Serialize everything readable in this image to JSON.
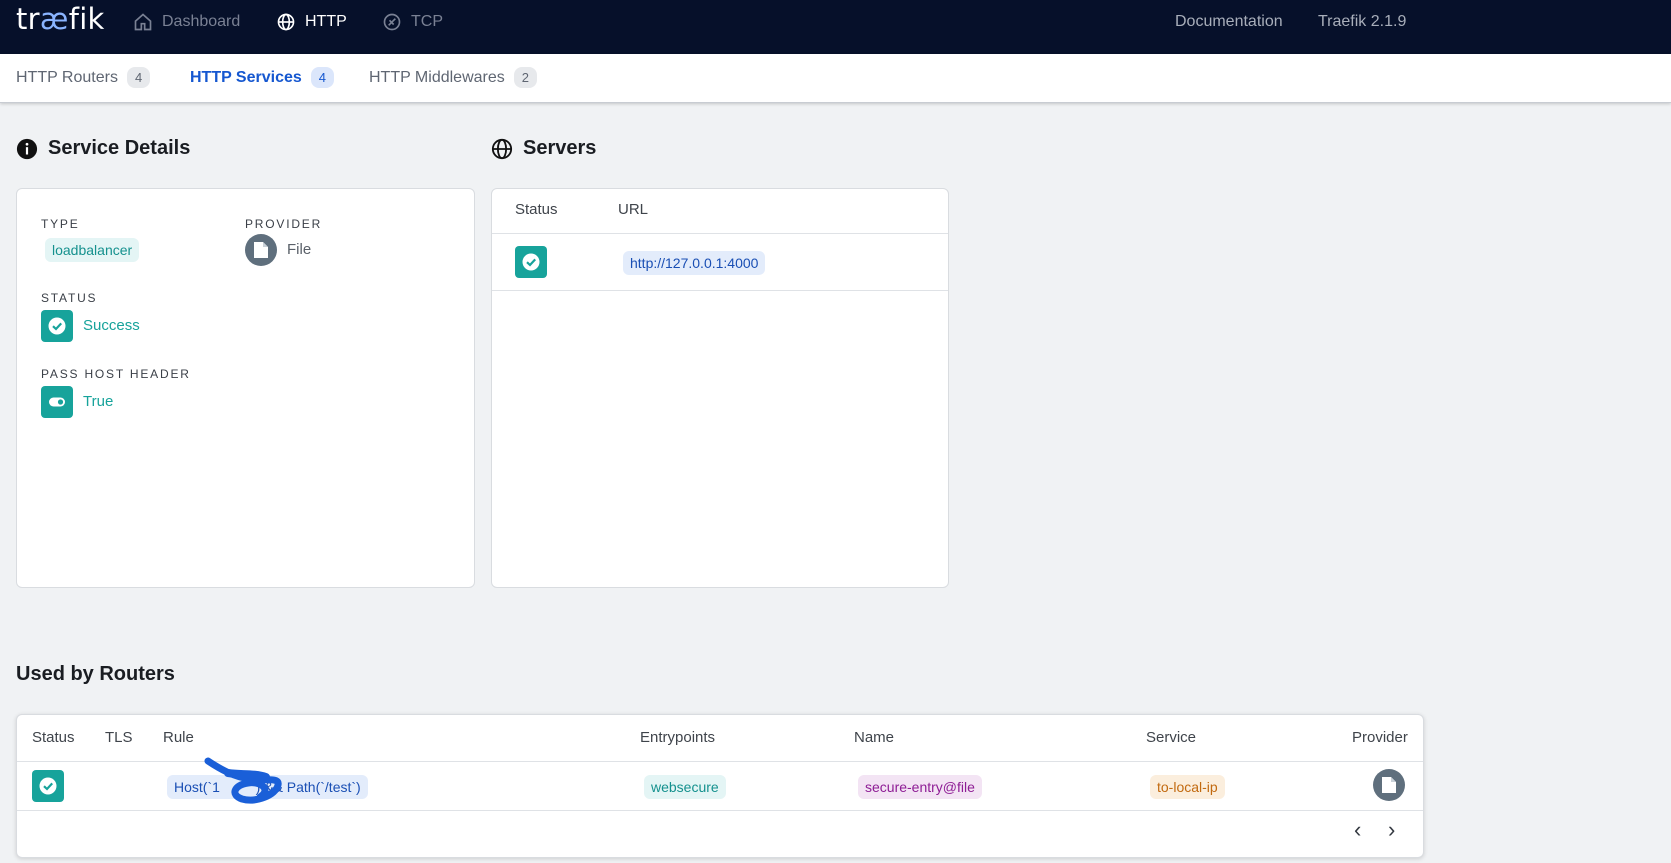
{
  "app": {
    "logo_prefix": "tr",
    "logo_ae": "æ",
    "logo_suffix": "fik",
    "brand_color": "#06102a",
    "accent_color": "#1557d0",
    "success_color": "#17a39b"
  },
  "topnav": {
    "dashboard": "Dashboard",
    "http": "HTTP",
    "tcp": "TCP",
    "documentation": "Documentation",
    "version": "Traefik 2.1.9"
  },
  "subnav": {
    "routers": {
      "label": "HTTP Routers",
      "count": "4"
    },
    "services": {
      "label": "HTTP Services",
      "count": "4",
      "active": true
    },
    "middlewares": {
      "label": "HTTP Middlewares",
      "count": "2"
    }
  },
  "service_details": {
    "title": "Service Details",
    "type_label": "TYPE",
    "type_value": "loadbalancer",
    "provider_label": "PROVIDER",
    "provider_value": "File",
    "status_label": "STATUS",
    "status_value": "Success",
    "pass_host_label": "PASS HOST HEADER",
    "pass_host_value": "True"
  },
  "servers": {
    "title": "Servers",
    "columns": [
      "Status",
      "URL"
    ],
    "rows": [
      {
        "status": "success",
        "url": "http://127.0.0.1:4000"
      }
    ]
  },
  "used_by_routers": {
    "title": "Used by Routers",
    "columns": [
      "Status",
      "TLS",
      "Rule",
      "Entrypoints",
      "Name",
      "Service",
      "Provider"
    ],
    "rows": [
      {
        "status": "success",
        "tls": "",
        "rule": "Host(`1        `) && Path(`/test`)",
        "entrypoint": "websecure",
        "name": "secure-entry@file",
        "service": "to-local-ip",
        "provider": "file-icon"
      }
    ]
  }
}
